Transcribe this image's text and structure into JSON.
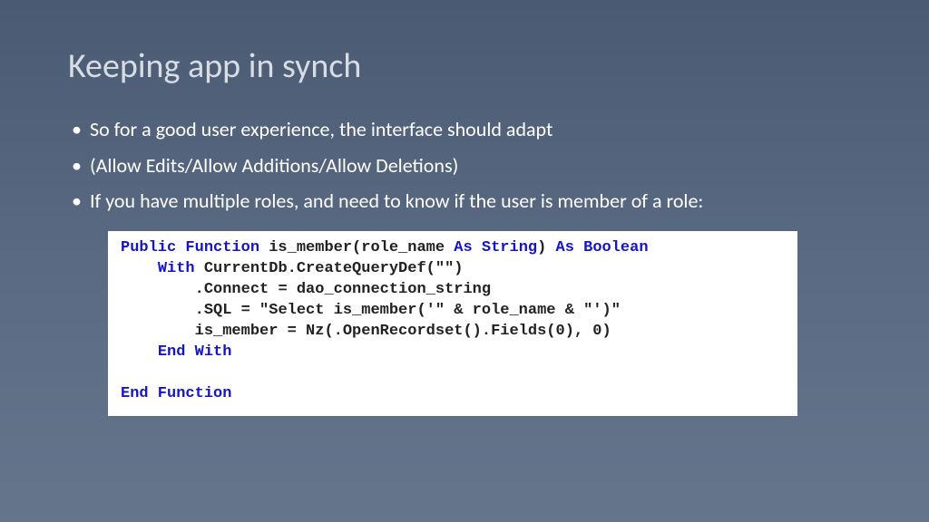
{
  "title": "Keeping app in synch",
  "bullets": [
    "So for a good user experience, the interface should adapt",
    " (Allow Edits/Allow Additions/Allow Deletions)",
    "If you have multiple roles, and need to know if the user is member of a role:"
  ],
  "code": {
    "l1_kw1": "Public Function",
    "l1_tx1": " is_member(role_name ",
    "l1_kw2": "As String",
    "l1_tx2": ") ",
    "l1_kw3": "As Boolean",
    "l2_kw1": "With",
    "l2_tx1": " CurrentDb.CreateQueryDef(\"\")",
    "l3_tx1": ".Connect = dao_connection_string",
    "l4_tx1": ".SQL = \"Select is_member('\" & role_name & \"')\"",
    "l5_tx1": "is_member = Nz(.OpenRecordset().Fields(0), 0)",
    "l6_kw1": "End With",
    "l7_kw1": "End Function"
  }
}
